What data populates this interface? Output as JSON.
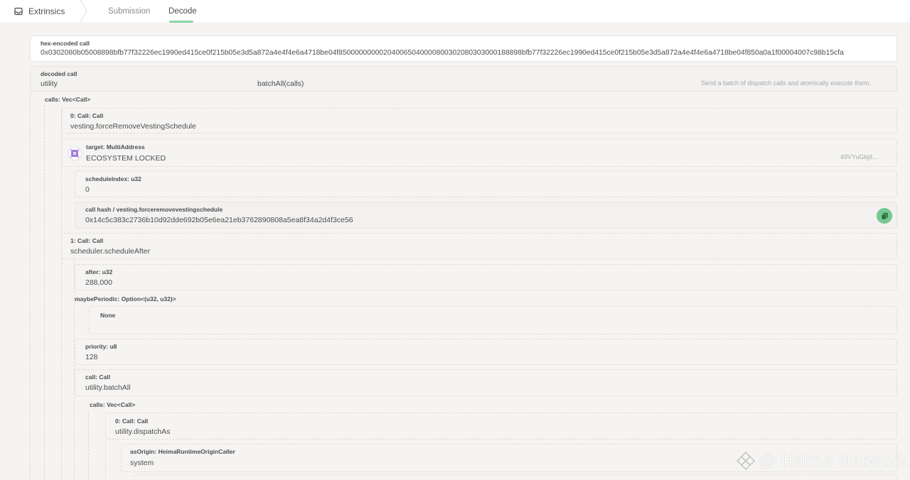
{
  "nav": {
    "section_label": "Extrinsics",
    "section_icon": "inbox-icon",
    "tabs": [
      {
        "label": "Submission",
        "active": false
      },
      {
        "label": "Decode",
        "active": true
      }
    ],
    "accent_color": "#8fd3a6"
  },
  "hex_call": {
    "label": "hex-encoded call",
    "value": "0x0302080b05008898bfb77f32226ec1990ed415ce0f215b05e3d5a872a4e4f4e6a4718be04f850000000002040065040000800302080303000188898bfb77f32226ec1990ed415ce0f215b05e3d5a872a4e4f4e6a4718be04f850a0a1f00004007c98b15cfa"
  },
  "decoded_call": {
    "label": "decoded call",
    "section": "utility",
    "method": "batchAll(calls)",
    "description": "Send a batch of dispatch calls and atomically execute them."
  },
  "calls": {
    "label": "calls: Vec<Call>",
    "call0": {
      "label": "0: Call: Call",
      "value": "vesting.forceRemoveVestingSchedule",
      "target": {
        "label": "target: MultiAddress",
        "value": "ECOSYSTEM LOCKED",
        "short_address": "49VYuGkjd..."
      },
      "schedule_index": {
        "label": "scheduleIndex: u32",
        "value": "0"
      },
      "call_hash": {
        "label": "call hash / vesting.forceremovevestingschedule",
        "value": "0x14c5c383c2736b10d92dde692b05e6ea21eb3762890808a5ea8f34a2d4f3ce56"
      }
    },
    "call1": {
      "label": "1: Call: Call",
      "value": "scheduler.scheduleAfter",
      "after": {
        "label": "after: u32",
        "value": "288,000"
      },
      "maybe_periodic": {
        "label": "maybePeriodic: Option<(u32, u32)>",
        "value": "None"
      },
      "priority": {
        "label": "priority: u8",
        "value": "128"
      },
      "inner_call": {
        "label": "call: Call",
        "value": "utility.batchAll"
      },
      "inner_calls": {
        "label": "calls: Vec<Call>",
        "call0": {
          "label": "0: Call: Call",
          "value": "utility.dispatchAs"
        },
        "as_origin": {
          "label": "asOrigin: HeimaRuntimeOriginCaller",
          "value": "system"
        }
      }
    }
  },
  "watermark": {
    "text": "@ Heima Network"
  }
}
